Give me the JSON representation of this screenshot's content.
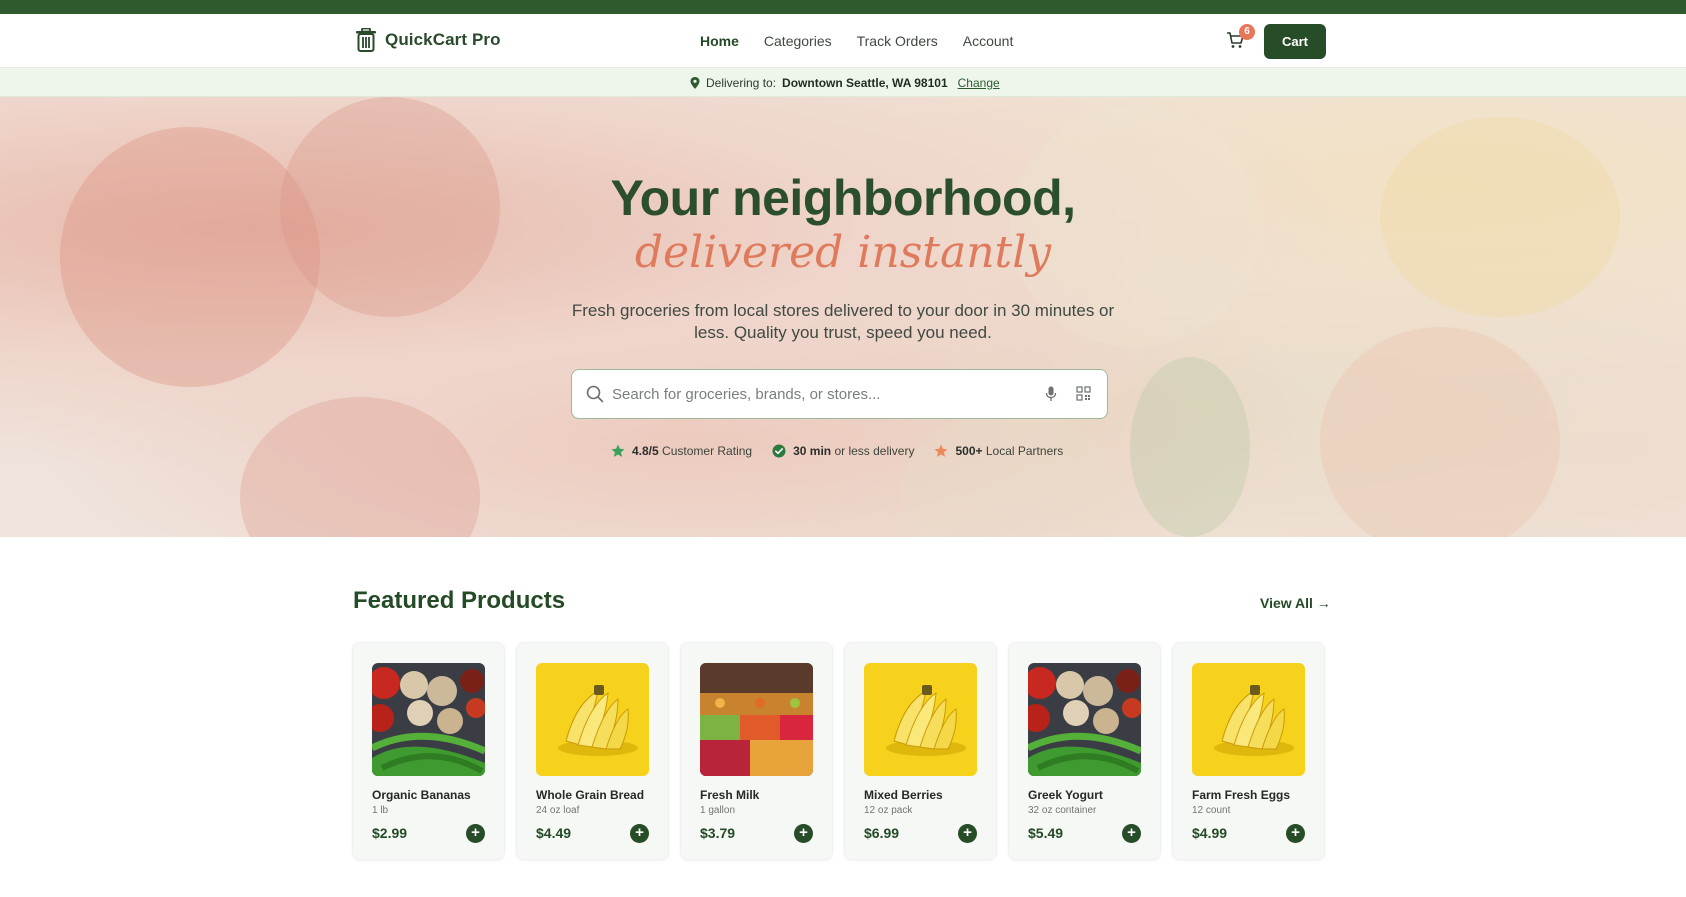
{
  "brand": {
    "name": "QuickCart Pro",
    "icon": "trash-bin-icon"
  },
  "nav": {
    "links": [
      "Home",
      "Categories",
      "Track Orders",
      "Account"
    ],
    "active": "Home"
  },
  "cart": {
    "count": "6",
    "button_label": "Cart",
    "icon": "cart-icon"
  },
  "delivery": {
    "prefix": "Delivering to:",
    "location": "Downtown Seattle, WA 98101",
    "change_label": "Change"
  },
  "hero": {
    "title": "Your neighborhood,",
    "tagline": "delivered instantly",
    "subtitle": "Fresh groceries from local stores delivered to your door in 30 minutes or less. Quality you trust, speed you need.",
    "search_placeholder": "Search for groceries, brands, or stores...",
    "stats": [
      {
        "value": "4.8/5",
        "label": "Customer Rating",
        "icon": "star-icon",
        "color": "#3aa05a"
      },
      {
        "value": "30 min",
        "label": "or less delivery",
        "icon": "check-circle-icon",
        "color": "#2d7a3e"
      },
      {
        "value": "500+",
        "label": "Local Partners",
        "icon": "star-icon",
        "color": "#ef8a5c"
      }
    ]
  },
  "featured": {
    "title": "Featured Products",
    "view_all": "View All →",
    "products": [
      {
        "name": "Organic Bananas",
        "unit": "1 lb",
        "price": "$2.99",
        "image": "vegetables"
      },
      {
        "name": "Whole Grain Bread",
        "unit": "24 oz loaf",
        "price": "$4.49",
        "image": "bananas"
      },
      {
        "name": "Fresh Milk",
        "unit": "1 gallon",
        "price": "$3.79",
        "image": "market"
      },
      {
        "name": "Mixed Berries",
        "unit": "12 oz pack",
        "price": "$6.99",
        "image": "bananas"
      },
      {
        "name": "Greek Yogurt",
        "unit": "32 oz container",
        "price": "$5.49",
        "image": "vegetables"
      },
      {
        "name": "Farm Fresh Eggs",
        "unit": "12 count",
        "price": "$4.99",
        "image": "bananas"
      }
    ]
  },
  "colors": {
    "primary": "#274d28",
    "accent": "#e07a5d",
    "topstrip": "#2f5a2e"
  }
}
